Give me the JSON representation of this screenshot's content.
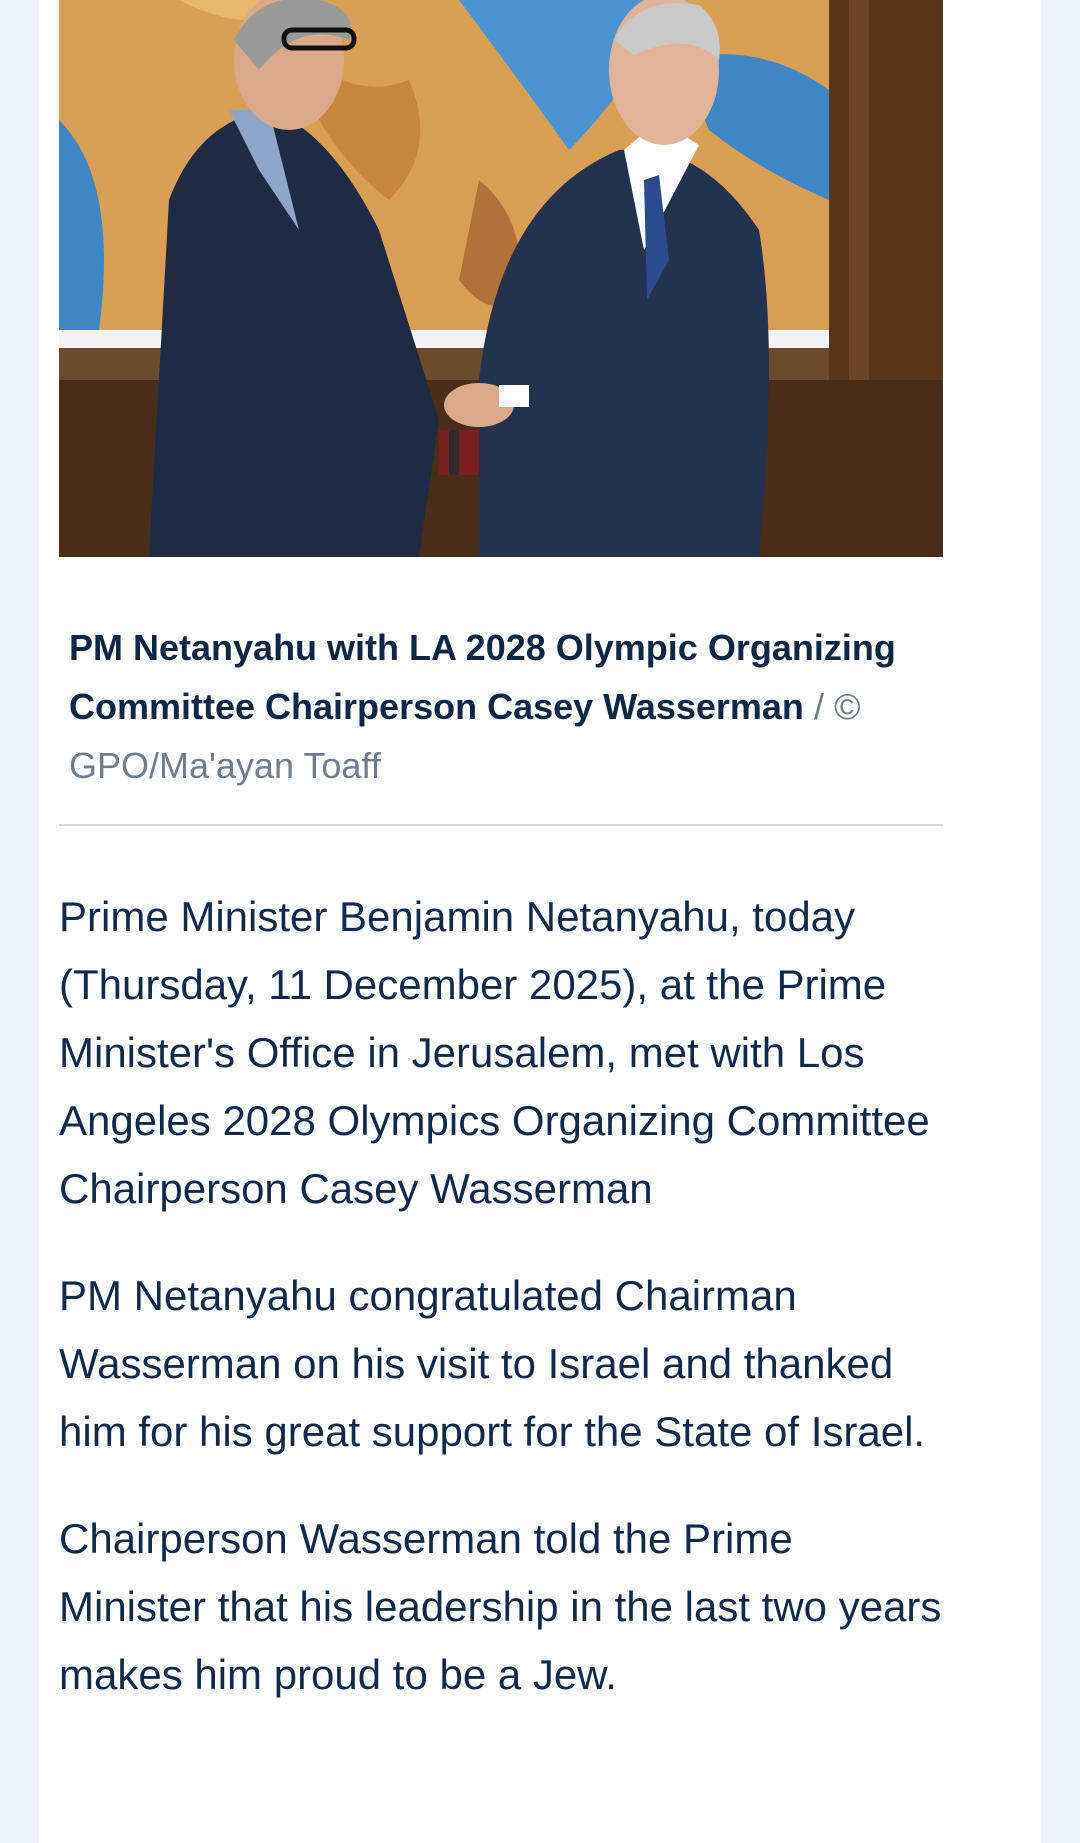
{
  "photo": {
    "alt": "PM Netanyahu with LA 2028 Olympic Organizing Committee Chairperson Casey Wasserman"
  },
  "caption": {
    "title": "PM Netanyahu with LA 2028 Olympic Organizing Committee Chairperson Casey Wasserman",
    "credit": " / © GPO/Ma'ayan Toaff"
  },
  "article": {
    "paragraphs": [
      "Prime Minister Benjamin Netanyahu, today (Thursday, 11 December 2025), at the Prime Minister's Office in Jerusalem, met with Los Angeles 2028 Olympics Organizing Committee Chairperson Casey Wasserman",
      "PM Netanyahu congratulated Chairman Wasserman on his visit to Israel and thanked him for his great support for the State of Israel.",
      "Chairperson Wasserman told the Prime Minister that his leadership in the last two years makes him proud to be a Jew."
    ]
  }
}
